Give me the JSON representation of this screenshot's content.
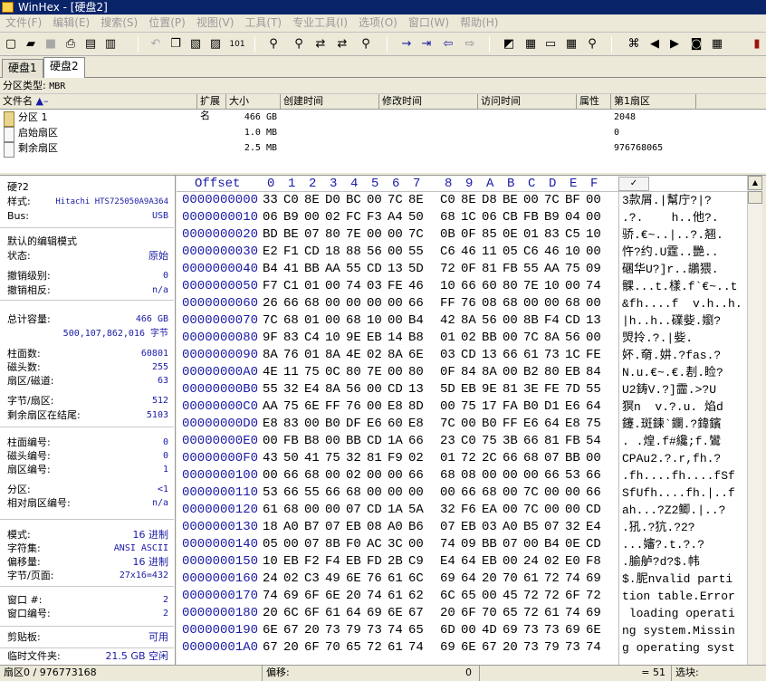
{
  "window": {
    "title": "WinHex - [硬盘2]"
  },
  "menu": [
    "文件(F)",
    "编辑(E)",
    "搜索(S)",
    "位置(P)",
    "视图(V)",
    "工具(T)",
    "专业工具(I)",
    "选项(O)",
    "窗口(W)",
    "帮助(H)"
  ],
  "tabs": [
    "硬盘1",
    "硬盘2"
  ],
  "partition_type": {
    "label": "分区类型:",
    "value": "MBR"
  },
  "file_table": {
    "columns": [
      "文件名",
      "扩展名",
      "大小",
      "创建时间",
      "修改时间",
      "访问时间",
      "属性",
      "第1扇区"
    ],
    "rows": [
      {
        "name": "分区 1",
        "size": "466 GB",
        "first_sector": "2048",
        "icon": "partition-icon"
      },
      {
        "name": "启始扇区",
        "size": "1.0 MB",
        "first_sector": "0",
        "icon": "file-icon"
      },
      {
        "name": "剩余扇区",
        "size": "2.5 MB",
        "first_sector": "976768065",
        "icon": "file-icon"
      }
    ]
  },
  "info": {
    "disk": {
      "title": "硬?2",
      "model_label": "样式:",
      "model": "Hitachi HTS725050A9A364",
      "bus_label": "Bus:",
      "bus": "USB"
    },
    "edit": {
      "title": "默认的编辑模式",
      "state_label": "状态:",
      "state": "原始",
      "undo_level_label": "撤销级别:",
      "undo_level": "0",
      "undo_reverse_label": "撤销相反:",
      "undo_reverse": "n/a"
    },
    "capacity": {
      "total_label": "总计容量:",
      "total": "466 GB",
      "bytes": "500,107,862,016 字节",
      "cyl_label": "柱面数:",
      "cyl": "60801",
      "heads_label": "磁头数:",
      "heads": "255",
      "spt_label": "扇区/磁道:",
      "spt": "63",
      "bps_label": "字节/扇区:",
      "bps": "512",
      "remain_label": "剩余扇区在结尾:",
      "remain": "5103"
    },
    "pos": {
      "cyl_label": "柱面编号:",
      "cyl": "0",
      "head_label": "磁头编号:",
      "head": "0",
      "sector_label": "扇区编号:",
      "sector": "1",
      "part_label": "分区:",
      "part": "<1",
      "rel_label": "相对扇区编号:",
      "rel": "n/a"
    },
    "mode": {
      "mode_label": "模式:",
      "mode": "16 进制",
      "charset_label": "字符集:",
      "charset": "ANSI ASCII",
      "offset_label": "偏移量:",
      "offset": "16 进制",
      "bpp_label": "字节/页面:",
      "bpp": "27x16=432"
    },
    "window": {
      "win_label": "窗口 #:",
      "win": "2",
      "count_label": "窗口编号:",
      "count": "2"
    },
    "clip": {
      "label": "剪贴板:",
      "value": "可用"
    },
    "temp": {
      "label": "临时文件夹:",
      "value": "21.5 GB 空闲"
    }
  },
  "hex": {
    "offset_header": "Offset",
    "col_headers": [
      "0",
      "1",
      "2",
      "3",
      "4",
      "5",
      "6",
      "7",
      "8",
      "9",
      "A",
      "B",
      "C",
      "D",
      "E",
      "F"
    ],
    "rows": [
      {
        "off": "0000000000",
        "bytes": "33 C0 8E D0 BC 00 7C 8E C0 8E D8 BE 00 7C BF 00",
        "text": "3款屑.|幫庁?|?"
      },
      {
        "off": "0000000010",
        "bytes": "06 B9 00 02 FC F3 A4 50 68 1C 06 CB FB B9 04 00",
        "text": ".?.    h..他?."
      },
      {
        "off": "0000000020",
        "bytes": "BD BE 07 80 7E 00 00 7C 0B 0F 85 0E 01 83 C5 10",
        "text": "骄.€~..|..?.翘."
      },
      {
        "off": "0000000030",
        "bytes": "E2 F1 CD 18 88 56 00 55 C6 46 11 05 C6 46 10 00",
        "text": "忤?约.U霆..艷.."
      },
      {
        "off": "0000000040",
        "bytes": "B4 41 BB AA 55 CD 13 5D 72 0F 81 FB 55 AA 75 09",
        "text": "碅华U?]r..鶘猥."
      },
      {
        "off": "0000000050",
        "bytes": "F7 C1 01 00 74 03 FE 46 10 66 60 80 7E 10 00 74",
        "text": "髁...t.樣.f`€~..t"
      },
      {
        "off": "0000000060",
        "bytes": "26 66 68 00 00 00 00 66 FF 76 08 68 00 00 68 00",
        "text": "&fh....f  v.h..h."
      },
      {
        "off": "0000000070",
        "bytes": "7C 68 01 00 68 10 00 B4 42 8A 56 00 8B F4 CD 13",
        "text": "|h..h..礏姕.嬼?"
      },
      {
        "off": "0000000080",
        "bytes": "9F 83 C4 10 9E EB 14 B8 01 02 BB 00 7C 8A 56 00",
        "text": "焽拎.?.|姕."
      },
      {
        "off": "0000000090",
        "bytes": "8A 76 01 8A 4E 02 8A 6E 03 CD 13 66 61 73 1C FE",
        "text": "妚.奛.妌.?fas.?"
      },
      {
        "off": "00000000A0",
        "bytes": "4E 11 75 0C 80 7E 00 80 0F 84 8A 00 B2 80 EB 84",
        "text": "N.u.€~.€.剨.睑?"
      },
      {
        "off": "00000000B0",
        "bytes": "55 32 E4 8A 56 00 CD 13 5D EB 9E 81 3E FE 7D 55",
        "text": "U2鋳V.?]霝.>?U"
      },
      {
        "off": "00000000C0",
        "bytes": "AA 75 6E FF 76 00 E8 8D 00 75 17 FA B0 D1 E6 64",
        "text": "猽n  v.?.u. 焰d"
      },
      {
        "off": "00000000D0",
        "bytes": "E8 83 00 B0 DF E6 60 E8 7C 00 B0 FF E6 64 E8 75",
        "text": "鑳.斑鍊`鑭.?鍏鑌"
      },
      {
        "off": "00000000E0",
        "bytes": "00 FB B8 00 BB CD 1A 66 23 C0 75 3B 66 81 FB 54",
        "text": ". .煌.f#纔;f.鸞"
      },
      {
        "off": "00000000F0",
        "bytes": "43 50 41 75 32 81 F9 02 01 72 2C 66 68 07 BB 00",
        "text": "CPAu2.?.r,fh.?"
      },
      {
        "off": "0000000100",
        "bytes": "00 66 68 00 02 00 00 66 68 08 00 00 00 66 53 66",
        "text": ".fh....fh....fSf"
      },
      {
        "off": "0000000110",
        "bytes": "53 66 55 66 68 00 00 00 00 66 68 00 7C 00 00 66",
        "text": "SfUfh....fh.|..f"
      },
      {
        "off": "0000000120",
        "bytes": "61 68 00 00 07 CD 1A 5A 32 F6 EA 00 7C 00 00 CD",
        "text": "ah...?Z2鲫.|..?"
      },
      {
        "off": "0000000130",
        "bytes": "18 A0 B7 07 EB 08 A0 B6 07 EB 03 A0 B5 07 32 E4",
        "text": ".犼.?犺.?2?"
      },
      {
        "off": "0000000140",
        "bytes": "05 00 07 8B F0 AC 3C 00 74 09 BB 07 00 B4 0E CD",
        "text": "...嬸?.t.?.?"
      },
      {
        "off": "0000000150",
        "bytes": "10 EB F2 F4 EB FD 2B C9 E4 64 EB 00 24 02 E0 F8",
        "text": ".腧舻?d?$.帏"
      },
      {
        "off": "0000000160",
        "bytes": "24 02 C3 49 6E 76 61 6C 69 64 20 70 61 72 74 69",
        "text": "$.胒nvalid parti"
      },
      {
        "off": "0000000170",
        "bytes": "74 69 6F 6E 20 74 61 62 6C 65 00 45 72 72 6F 72",
        "text": "tion table.Error"
      },
      {
        "off": "0000000180",
        "bytes": "20 6C 6F 61 64 69 6E 67 20 6F 70 65 72 61 74 69",
        "text": " loading operati"
      },
      {
        "off": "0000000190",
        "bytes": "6E 67 20 73 79 73 74 65 6D 00 4D 69 73 73 69 6E",
        "text": "ng system.Missin"
      },
      {
        "off": "00000001A0",
        "bytes": "67 20 6F 70 65 72 61 74 69 6E 67 20 73 79 73 74",
        "text": "g operating syst"
      }
    ]
  },
  "status": {
    "sector": "扇区0 / 976773168",
    "offset_label": "偏移:",
    "offset": "0",
    "value": "= 51",
    "sel_label": "选块:"
  }
}
